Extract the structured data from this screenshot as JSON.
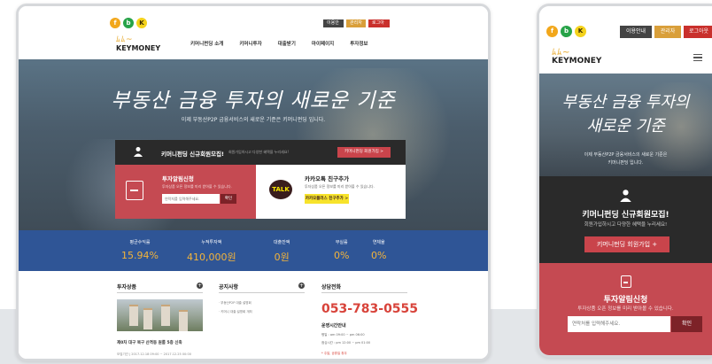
{
  "desktop": {
    "social": [
      "f",
      "b",
      "K"
    ],
    "util": [
      "이용안내",
      "관리자",
      "로그아웃"
    ],
    "logo_mark": "ﾑﾑ~",
    "logo_text": "KEYMONEY",
    "nav": [
      "키머니펀딩 소개",
      "키머니투자",
      "대출받기",
      "마이페이지",
      "투자정보"
    ],
    "hero_title": "부동산 금융 투자의 새로운 기준",
    "hero_sub": "이제 부동산P2P 금융서비스의 새로운 기준은 키머니펀딩 입니다.",
    "member_title": "키머니펀딩 신규회원모집!",
    "member_desc": "회원가입하시고 다양한 혜택을 누리세요!",
    "member_btn": "키머니펀딩 회원가입 >",
    "alarm_title": "투자알림신청",
    "alarm_desc": "투자상품 오픈 정보를 미리 받아볼 수 있습니다.",
    "alarm_placeholder": "연락처를 입력해주세요.",
    "alarm_btn": "확인",
    "kakao_talk": "TALK",
    "kakao_title": "카카오톡 친구추가",
    "kakao_desc": "투자상품 오픈 정보를 미리 받아볼 수 있습니다.",
    "kakao_btn": "카카오플러스 친구추가 >",
    "stats": [
      {
        "label": "평균수익률",
        "value": "15.94%"
      },
      {
        "label": "누적투자액",
        "value": "410,000원"
      },
      {
        "label": "대출잔액",
        "value": "0원"
      },
      {
        "label": "부실률",
        "value": "0%"
      },
      {
        "label": "연체율",
        "value": "0%"
      }
    ],
    "col_product": "투자상품",
    "col_notice": "공지사항",
    "col_contact": "상담전화",
    "plus": "+",
    "product_title": "제0차 대구 북구 산격동 원룸 5층 신축",
    "product_date": "모집기간 | 2017.12.18 09:00 ~ 2017.12.25 00:00",
    "notices": [
      "· 부동산P2P 대출 설명회",
      "· 키머니 대출 설명회 개최"
    ],
    "phone": "053-783-0555",
    "hours_title": "운영시간안내",
    "hours": [
      "평일 : am 09:00 ~ pm 06:00",
      "점심시간 : pm 12:00 ~ pm 01:00"
    ],
    "hours_note": "* 주말, 공휴일 휴무"
  },
  "mobile": {
    "social": [
      "f",
      "b",
      "K"
    ],
    "util": [
      "이용안내",
      "관리자",
      "로그아웃"
    ],
    "logo_mark": "ﾑﾑ~",
    "logo_text": "KEYMONEY",
    "hero_t1": "부동산 금융 투자의",
    "hero_t2": "새로운 기준",
    "hero_s1": "이제 부동산P2P 금융서비스의 새로운 기준은",
    "hero_s2": "키머니펀딩 입니다.",
    "member_title": "키머니펀딩 신규회원모집!",
    "member_desc": "회원가입하시고 다양한 혜택을 누리세요!",
    "member_btn": "키머니펀딩 회원가입 +",
    "alarm_title": "투자알림신청",
    "alarm_desc": "투자상품 오픈 정보를 미리 받아볼 수 있습니다.",
    "alarm_placeholder": "연락처를 입력해주세요.",
    "alarm_btn": "확인"
  },
  "colors": {
    "accent_red": "#c54a52",
    "stats_blue": "#2f5596",
    "stat_value": "#f4b43a",
    "kakao_yellow": "#f7e32b"
  }
}
